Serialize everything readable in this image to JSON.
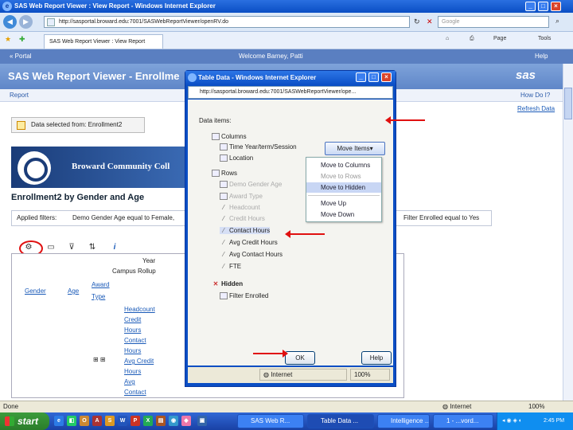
{
  "browser": {
    "title": "SAS Web Report Viewer : View Report - Windows Internet Explorer",
    "address": "http://sasportal.broward.edu:7001/SASWebReportViewer/openRV.do",
    "search_placeholder": "Google",
    "tab_label": "SAS Web Report Viewer : View Report",
    "commands": {
      "page": "Page",
      "tools": "Tools"
    },
    "status_left": "Done",
    "status_zone": "Internet",
    "zoom": "100%"
  },
  "portal": {
    "back_link": "« Portal",
    "welcome": "Welcome Barney, Patti",
    "help": "Help"
  },
  "report_viewer": {
    "app_title": "SAS Web Report Viewer - Enrollme",
    "logo": "sas",
    "menu_report": "Report",
    "menu_howdoi": "How Do I?",
    "refresh": "Refresh Data"
  },
  "report": {
    "data_source_label": "Data selected from:",
    "data_source_value": "Enrollment2",
    "banner_text": "Broward Community Coll",
    "title": "Enrollment2 by Gender and Age",
    "filters_label": "Applied filters:",
    "filters_value": "Demo Gender Age equal to Female,",
    "filters_right": "Filter Enrolled equal to Yes"
  },
  "crosstab": {
    "row_year": "Year",
    "row_campus": "Campus Rollup",
    "col_gender": "Gender",
    "col_age": "Age",
    "col_award": "Award",
    "col_type": "Type",
    "measures": [
      "Headcount",
      "Credit",
      "Hours",
      "Contact",
      "Hours",
      "Avg Credit",
      "Hours",
      "Avg",
      "Contact"
    ]
  },
  "dialog": {
    "title": "Table Data - Windows Internet Explorer",
    "address": "http://sasportal.broward.edu:7001/SASWebReportViewer/ope...",
    "data_items_label": "Data items:",
    "move_button": "Move Items▾",
    "tree": {
      "columns_label": "Columns",
      "columns": [
        "Time Year/term/Session",
        "Location"
      ],
      "rows_label": "Rows",
      "rows": [
        "Demo Gender Age",
        "Award Type",
        "Headcount",
        "Credit Hours",
        "Contact Hours",
        "Avg Credit Hours",
        "Avg Contact Hours",
        "FTE"
      ],
      "hidden_label": "Hidden",
      "hidden": [
        "Filter Enrolled"
      ]
    },
    "menu": [
      "Move to Columns",
      "Move to Rows",
      "Move to Hidden",
      "Move Up",
      "Move Down"
    ],
    "ok": "OK",
    "help": "Help",
    "status_zone": "Internet",
    "zoom": "100%"
  },
  "taskbar": {
    "start": "start",
    "tasks": [
      "SAS Web R...",
      "Table Data ...",
      "Intelligence ...",
      "1 - ...vord..."
    ],
    "clock": "2:45 PM"
  },
  "colors": {
    "annotation_red": "#e01010",
    "xp_blue": "#0a4ec4",
    "sas_blue": "#5a7fc1"
  }
}
